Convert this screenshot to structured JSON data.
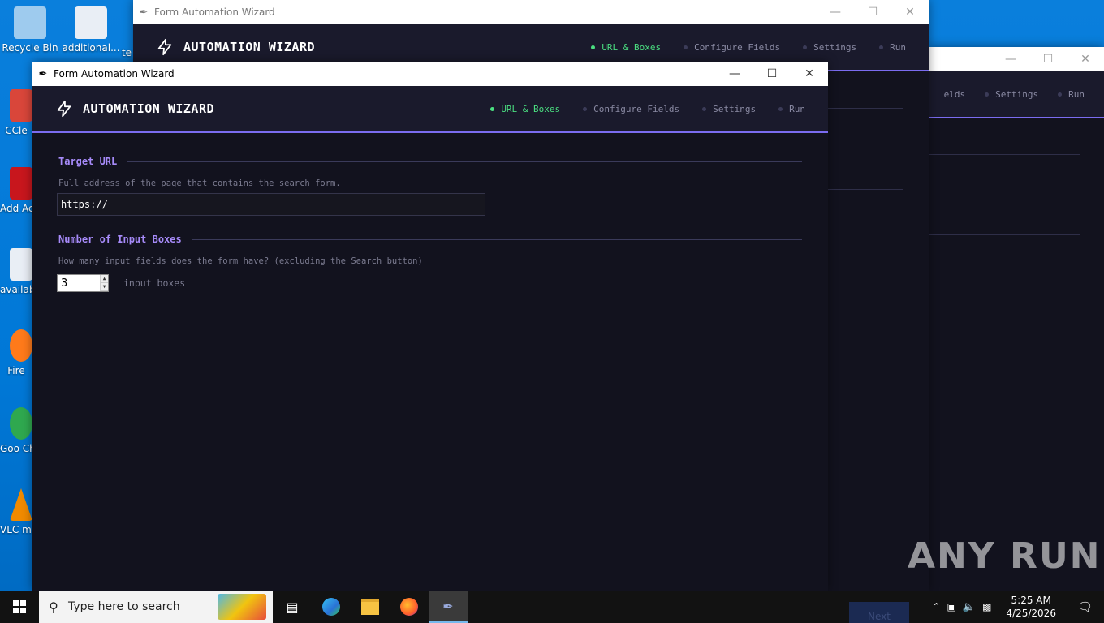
{
  "desktop": {
    "icons": [
      {
        "label": "Recycle Bin",
        "color": "#9ecbee"
      },
      {
        "label": "additional...",
        "color": "#e9eef5"
      },
      {
        "label": "CCle",
        "color": "#d9463a"
      },
      {
        "label": "Add Acro",
        "color": "#c8161d"
      },
      {
        "label": "availab",
        "color": "#e9eef5"
      },
      {
        "label": "Fire",
        "color": "#ff7a1a"
      },
      {
        "label": "Goo Chro",
        "color": "#2fa84f"
      },
      {
        "label": "VLC m play",
        "color": "#f08a00"
      }
    ],
    "partial_icon_text": "te"
  },
  "back_window": {
    "title": "Form Automation Wizard",
    "brand": "AUTOMATION WIZARD",
    "steps": [
      "URL & Boxes",
      "Configure Fields",
      "Settings",
      "Run"
    ]
  },
  "third_window": {
    "steps": [
      "elds",
      "Settings",
      "Run"
    ]
  },
  "front_window": {
    "title": "Form Automation Wizard",
    "brand": "AUTOMATION WIZARD",
    "steps": [
      {
        "label": "URL & Boxes",
        "active": true
      },
      {
        "label": "Configure Fields",
        "active": false
      },
      {
        "label": "Settings",
        "active": false
      },
      {
        "label": "Run",
        "active": false
      }
    ],
    "target_url": {
      "heading": "Target URL",
      "hint": "Full address of the page that contains the search form.",
      "value": "https://"
    },
    "input_boxes": {
      "heading": "Number of Input Boxes",
      "hint": "How many input fields does the form have? (excluding the Search button)",
      "value": "3",
      "suffix": "input boxes"
    }
  },
  "partial_next_button": "Next",
  "taskbar": {
    "search_placeholder": "Type here to search",
    "time": "5:25 AM",
    "date": "4/25/2026"
  },
  "watermark": "ANY RUN",
  "colors": {
    "accent": "#7b6cf0",
    "active_step": "#4ade80",
    "section_heading": "#a78bfa",
    "background": "#12121e"
  }
}
